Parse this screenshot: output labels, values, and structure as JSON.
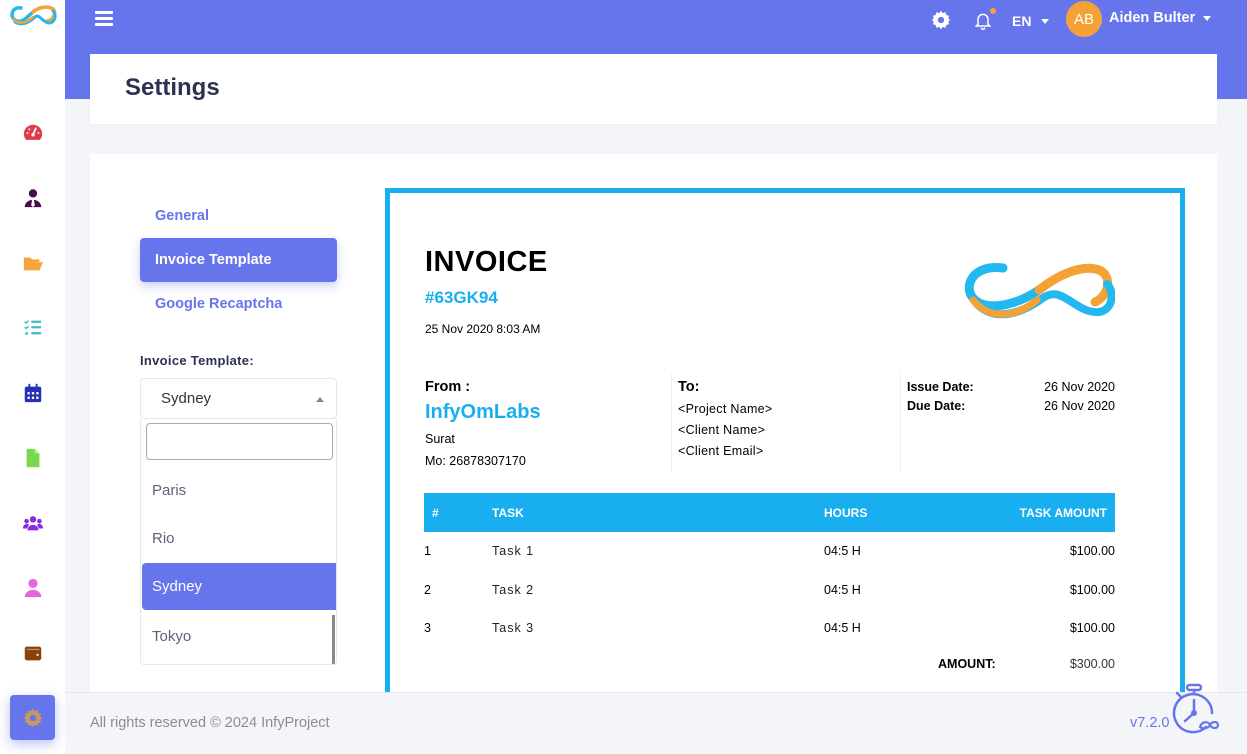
{
  "brand": {
    "logo_icon": "infinity-logo-icon",
    "colors": {
      "primary": "#6675ec",
      "accent_blue": "#19aeef",
      "accent_orange": "#f4a236"
    }
  },
  "sidebar": {
    "items": [
      {
        "name": "dashboard",
        "icon": "speedometer-icon",
        "color": "#e03b4d"
      },
      {
        "name": "clients",
        "icon": "user-tie-icon",
        "color": "#4b0b4f"
      },
      {
        "name": "projects",
        "icon": "folder-open-icon",
        "color": "#f6a53a"
      },
      {
        "name": "tasks",
        "icon": "list-check-icon",
        "color": "#3fbac7"
      },
      {
        "name": "calendar",
        "icon": "calendar-icon",
        "color": "#2431b8"
      },
      {
        "name": "invoices",
        "icon": "file-icon",
        "color": "#7ad84f"
      },
      {
        "name": "users",
        "icon": "users-icon",
        "color": "#8a2be2"
      },
      {
        "name": "profile",
        "icon": "user-icon",
        "color": "#e864e3"
      },
      {
        "name": "expenses",
        "icon": "wallet-icon",
        "color": "#8a4208"
      },
      {
        "name": "settings",
        "icon": "gear-icon",
        "color": "#c89860",
        "active": true
      }
    ]
  },
  "header": {
    "menu_icon": "hamburger-icon",
    "settings_icon": "gear-icon",
    "notification_icon": "bell-icon",
    "language": "EN",
    "user": {
      "initials": "AB",
      "name": "Aiden Bulter"
    }
  },
  "page": {
    "title": "Settings"
  },
  "settings_nav": {
    "items": [
      {
        "label": "General",
        "active": false
      },
      {
        "label": "Invoice Template",
        "active": true
      },
      {
        "label": "Google Recaptcha",
        "active": false
      }
    ]
  },
  "template_select": {
    "label": "Invoice Template:",
    "selected": "Sydney",
    "search_value": "",
    "options": [
      "Paris",
      "Rio",
      "Sydney",
      "Tokyo"
    ]
  },
  "invoice": {
    "title": "INVOICE",
    "number": "#63GK94",
    "datetime": "25 Nov 2020 8:03 AM",
    "from": {
      "heading": "From :",
      "company": "InfyOmLabs",
      "city": "Surat",
      "mobile": "Mo: 26878307170"
    },
    "to": {
      "heading": "To:",
      "project": "<Project Name>",
      "client_name": "<Client Name>",
      "client_email": "<Client Email>"
    },
    "dates": {
      "issue_label": "Issue Date:",
      "issue_value": "26 Nov 2020",
      "due_label": "Due Date:",
      "due_value": "26 Nov 2020"
    },
    "table": {
      "headers": [
        "#",
        "TASK",
        "HOURS",
        "TASK AMOUNT"
      ],
      "rows": [
        [
          "1",
          "Task  1",
          "04:5 H",
          "$100.00"
        ],
        [
          "2",
          "Task  2",
          "04:5 H",
          "$100.00"
        ],
        [
          "3",
          "Task  3",
          "04:5 H",
          "$100.00"
        ]
      ]
    },
    "total": {
      "label": "AMOUNT:",
      "value": "$300.00"
    }
  },
  "footer": {
    "copyright": "All rights reserved © 2024 InfyProject",
    "version": "v7.2.0",
    "timer_icon": "stopwatch-icon"
  }
}
